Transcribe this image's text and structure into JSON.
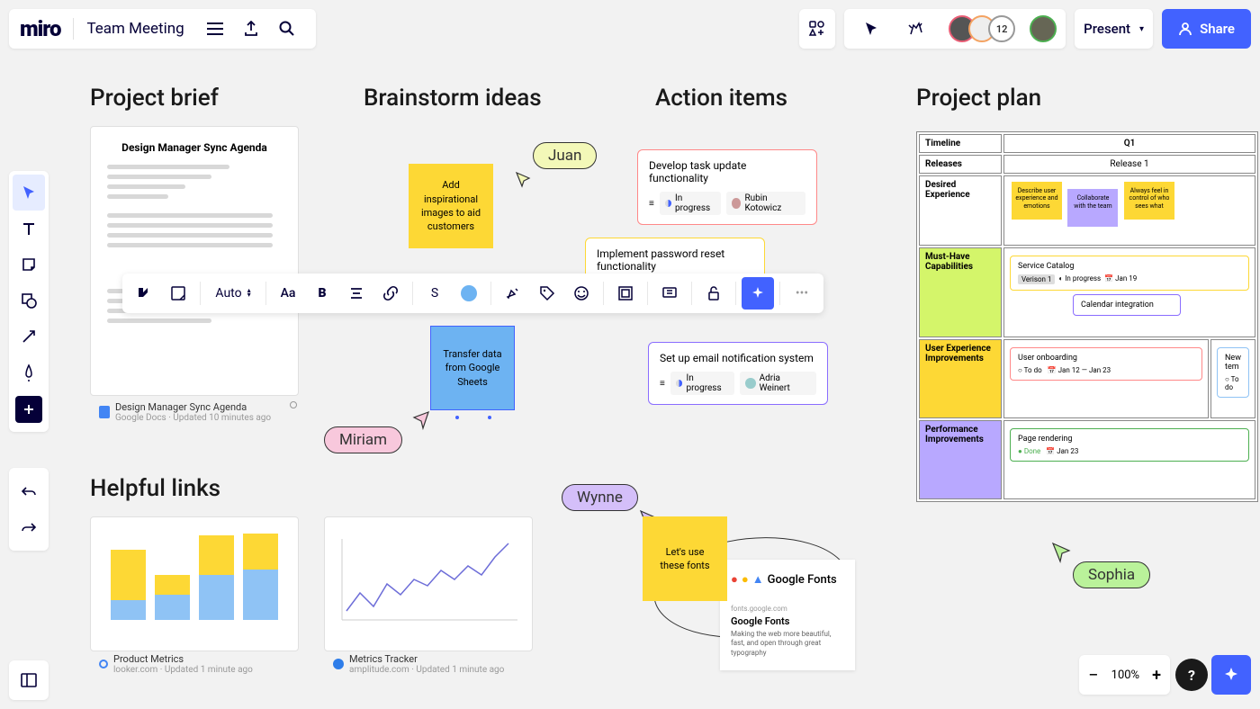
{
  "header": {
    "logo": "miro",
    "board_title": "Team Meeting",
    "participant_count": "12",
    "present_label": "Present",
    "share_label": "Share"
  },
  "sections": {
    "brief": "Project brief",
    "brainstorm": "Brainstorm ideas",
    "actions": "Action items",
    "plan": "Project plan",
    "links": "Helpful links"
  },
  "doc": {
    "title": "Design Manager Sync Agenda",
    "meta_title": "Design Manager Sync Agenda",
    "source": "Google Docs",
    "updated": "Updated 10 minutes ago"
  },
  "stickies": {
    "inspirational": "Add inspirational images to aid customers",
    "transfer": "Transfer data from Google Sheets",
    "fonts": "Let's use these fonts"
  },
  "cursors": {
    "juan": "Juan",
    "miriam": "Miriam",
    "wynne": "Wynne",
    "sophia": "Sophia"
  },
  "tasks": {
    "t1": {
      "title": "Develop task update functionality",
      "status": "In progress",
      "assignee": "Rubin Kotowicz"
    },
    "t2": {
      "title": "Implement password reset functionality"
    },
    "t3": {
      "title": "Set up email notification system",
      "status": "In progress",
      "assignee": "Adria Weinert"
    }
  },
  "links": {
    "l1": {
      "title": "Product Metrics",
      "source": "looker.com",
      "updated": "Updated 1 minute ago"
    },
    "l2": {
      "title": "Metrics Tracker",
      "source": "amplitude.com",
      "updated": "Updated 1 minute ago"
    }
  },
  "gfonts": {
    "title": "Google Fonts",
    "url": "fonts.google.com",
    "heading": "Google Fonts",
    "desc": "Making the web more beautiful, fast, and open through great typography"
  },
  "plan": {
    "timeline": "Timeline",
    "q1": "Q1",
    "releases": "Releases",
    "release1": "Release 1",
    "row2": "Desired Experience",
    "row3": "Must-Have Capabilities",
    "row4": "User Experience Improvements",
    "row5": "Performance Improvements",
    "s1": "Describe user experience and emotions",
    "s2": "Collaborate with the team",
    "s3": "Always feel in control of who sees what",
    "catalog": {
      "title": "Service Catalog",
      "version": "Verison 1",
      "status": "In progress",
      "date": "Jan 19"
    },
    "calendar": "Calendar integration",
    "onboard": {
      "title": "User onboarding",
      "status": "To do",
      "date": "Jan 12 — Jan 23"
    },
    "newtem": {
      "title": "New tem",
      "status": "To do"
    },
    "render": {
      "title": "Page rendering",
      "status": "Done",
      "date": "Jan 23"
    }
  },
  "ctx": {
    "auto": "Auto",
    "size": "S",
    "font": "Aa",
    "bold": "B"
  },
  "zoom": {
    "level": "100%"
  }
}
